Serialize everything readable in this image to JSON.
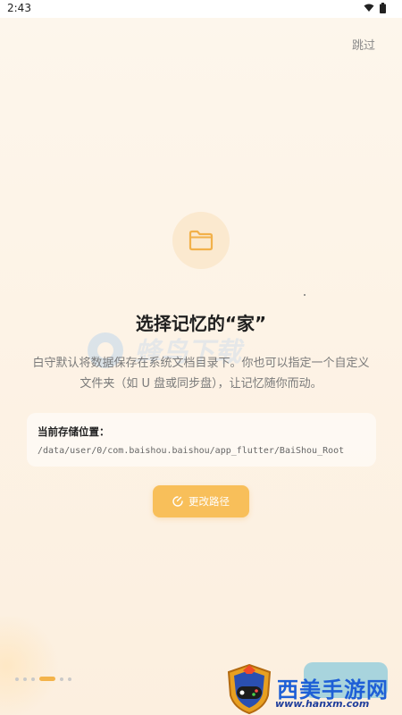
{
  "status_bar": {
    "time": "2:43"
  },
  "header": {
    "skip_label": "跳过"
  },
  "main": {
    "title": "选择记忆的“家”",
    "description": "白守默认将数据保存在系统文档目录下。你也可以指定一个自定义文件夹（如 U 盘或同步盘），让记忆随你而动。",
    "storage_card": {
      "label": "当前存储位置：",
      "path": "/data/user/0/com.baishou.baishou/app_flutter/BaiShou_Root"
    },
    "change_button_label": "更改路径"
  },
  "pager": {
    "total": 5,
    "active_index": 3
  },
  "watermark": {
    "text": "蜂鸟下载"
  },
  "footer_badge": {
    "title": "西美手游网",
    "url": "www.hanxm.com"
  },
  "colors": {
    "accent": "#f8bf5a",
    "folder_bg": "#fbe9cf",
    "next_button": "#9ed0dd"
  }
}
